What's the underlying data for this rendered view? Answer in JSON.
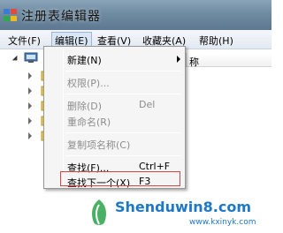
{
  "window": {
    "title": "注册表编辑器"
  },
  "menubar": {
    "items": [
      {
        "label": "文件(F)"
      },
      {
        "label": "编辑(E)"
      },
      {
        "label": "查看(V)"
      },
      {
        "label": "收藏夹(A)"
      },
      {
        "label": "帮助(H)"
      }
    ]
  },
  "list_header": {
    "name_col": "称"
  },
  "edit_menu": {
    "items": [
      {
        "label": "新建(N)",
        "shortcut": "",
        "disabled": false,
        "submenu": true
      },
      {
        "label": "权限(P)...",
        "shortcut": "",
        "disabled": true
      },
      {
        "label": "删除(D)",
        "shortcut": "Del",
        "disabled": true
      },
      {
        "label": "重命名(R)",
        "shortcut": "",
        "disabled": true
      },
      {
        "label": "复制项名称(C)",
        "shortcut": "",
        "disabled": true
      },
      {
        "label": "查找(F)...",
        "shortcut": "Ctrl+F",
        "disabled": false
      },
      {
        "label": "查找下一个(X)",
        "shortcut": "F3",
        "disabled": false,
        "highlighted": true
      }
    ]
  },
  "watermark": {
    "text": "Shenduwin8.com",
    "url": "www.kxinyk.com"
  },
  "colors": {
    "highlight_border": "#e0443e",
    "watermark": "#1e78c8",
    "folder": "#e8c94a"
  }
}
